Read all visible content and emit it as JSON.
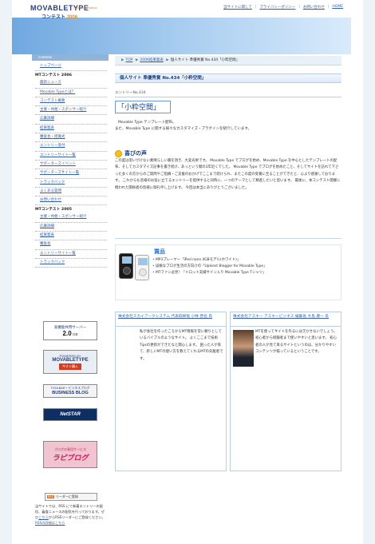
{
  "header": {
    "logo_main": "MOVABLETYPE",
    "logo_sub": "Publishing Platform",
    "logo_contest": "コンテスト",
    "logo_year": "2006",
    "links": [
      "当サイトに関して",
      "プライバシーポリシー",
      "お問い合わせ",
      "HOME"
    ]
  },
  "sidebar": {
    "contents_label": "contents",
    "group1_items": [
      "トップページ",
      "最新ニュース",
      "Movable Typeとは？",
      "コンテスト概要",
      "主催・共催・スポンサー紹介",
      "応募詳細",
      "結果発表",
      "審査会・授賞式",
      "エントリー受付",
      "エントリーサイト一覧",
      "サポーターズイベント",
      "サポーターズサイト一覧",
      "トラックバック",
      "よくある質問",
      "お問い合わせ"
    ],
    "group2_head": "MTコンテスト 2005",
    "group1_head": "MTコンテスト 2006",
    "group2_items": [
      "主催・共催・スポンサー紹介",
      "応募詳細",
      "結果発表",
      "審査会",
      "エントリーサイト一覧",
      "トラックバック"
    ],
    "banners": {
      "b1_line1": "高機能共用サーバー",
      "b1_line2": "2.0",
      "b1_unit": "GB",
      "b2_top": "POWERED BY",
      "b2_main": "MOVABLETYPE",
      "b2_go": "今すぐ購入",
      "b3_top": "TOOLBAR + ビジネスブログ",
      "b3_main": "BUSINESS BLOG",
      "b4_main": "NetSTAR",
      "b5_top": "ブログの専用サービス",
      "b5_main": "ラピブログ"
    },
    "rss_button": "リーダーに登録",
    "rss_button_icon": "RSS",
    "rss_text": "当サイトでは、RSS にて新着エントリーの配信、審査ニュースの配信を行っております。ぜひ",
    "rss_link1": "こちら",
    "rss_text2": "からRSSリーダーにご登録ください。",
    "rss_link2": "RSSの詳細はこちら"
  },
  "main": {
    "breadcrumb": [
      "TOP",
      "2006結果発表",
      "個人サイト 準優秀賞 No.434「小粋空間」"
    ],
    "section_title": "個人サイト 準優秀賞 No.434「小粋空間」",
    "entry_no": "エントリーNo.434",
    "entry_title": "「小粋空間」",
    "desc_line1": "Movable Type テンプレート配布。",
    "desc_line2": "また、Movable Type に関する様々なカスタマイズ・プラグインを紹介しています。",
    "voice_heading": "喜びの声",
    "voice_text": "この度は思いがけない素晴らしい賞を頂き、大変光栄です。 Movable Type でブログを始め、Movable Type を中心としたテンプレートの配布、そしてカスタマイズ記事を書き続け、あっという間の3年近くでした。 Movable Type でブログを始めたこと、そしてサイトを訪れて下さった多くの方からのご質問やご指摘・ご支援のおかげでここまで続けられ、またこの度の受賞に至ることができたと、心より感謝しております。 これからも皆様のお役に立てるエントリーを提供すると同時に、一つのテーマとして精進したいと思います。 最後に、本コンテスト開催に携われた関係者の皆様に御礼申し上げます。 今回は本当にありがとうございました。",
    "prize_heading": "賞品",
    "prize_items": [
      "MP3プレーヤー「iPod nano 4GBモデル(ホワイト)」",
      "誤植なブログ生活の方向けの「Upkiest Blogger for Movable Type」",
      "MTファン必見！「トロット夫婦サイン入り Movable Type Tシャツ」"
    ],
    "judge1_title": "株式会社スカイアークシステム 代表取締役 小林 晋也 氏",
    "judge1_text": "私が会社を作ったころからMT情報を常に頼りとしているバイブルのようなサイト。 よくここまで技術Tipsの更新ができたなと関心します。 困った人が来て、新しいMTの使い方を教えてくれるMTの先駆者です。",
    "judge2_title": "株式会社アスキー アスキービジネス 編集長 大島 康一 氏",
    "judge2_text": "MTを使ってサイトを作るには欠かせないでしょう。 初心者から経験者まで使いやすいと思います。 初心者の人が見て来るサイトというのは、分かりやすいコンテンツが揃っているということです。"
  }
}
